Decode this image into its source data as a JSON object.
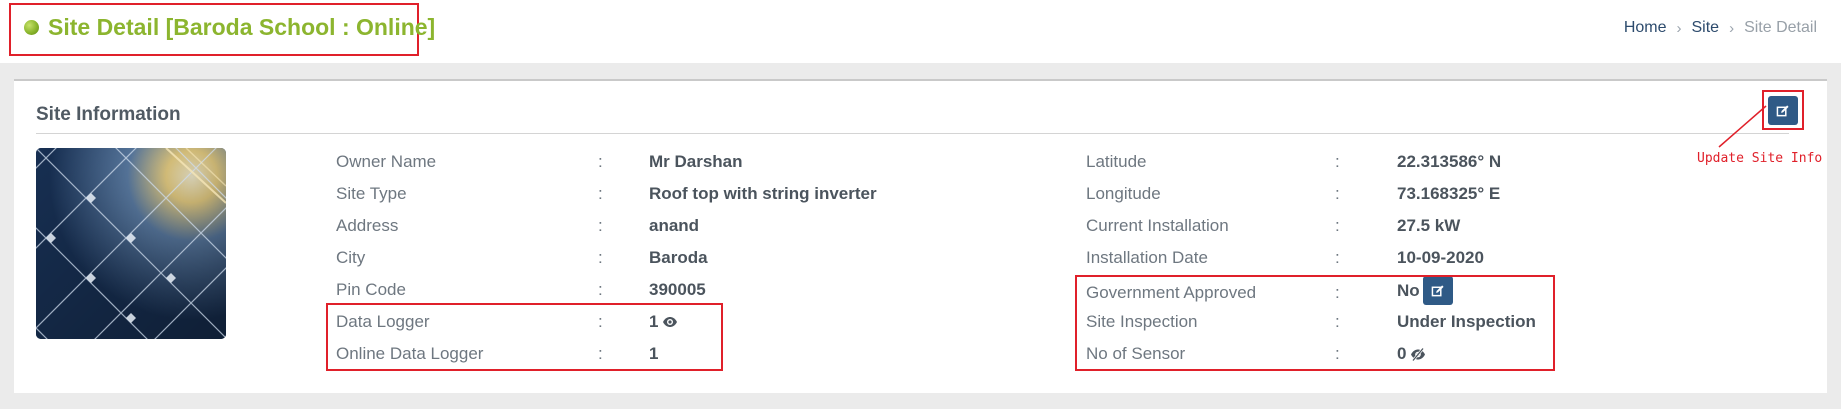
{
  "header": {
    "title": "Site Detail [Baroda School : Online]",
    "status_color": "#8cb52f",
    "breadcrumb": [
      {
        "label": "Home"
      },
      {
        "label": "Site"
      },
      {
        "label": "Site Detail"
      }
    ]
  },
  "card": {
    "title": "Site Information",
    "edit_icon": "edit-icon",
    "annotation_label": "Update Site Info"
  },
  "left_details": [
    {
      "label": "Owner Name",
      "value": "Mr Darshan"
    },
    {
      "label": "Site Type",
      "value": "Roof top with string inverter"
    },
    {
      "label": "Address",
      "value": "anand"
    },
    {
      "label": "City",
      "value": "Baroda"
    },
    {
      "label": "Pin Code",
      "value": "390005"
    },
    {
      "label": "Data Logger",
      "value": "1",
      "icon": "eye-icon"
    },
    {
      "label": "Online Data Logger",
      "value": "1"
    }
  ],
  "right_details": [
    {
      "label": "Latitude",
      "value": "22.313586° N"
    },
    {
      "label": "Longitude",
      "value": "73.168325° E"
    },
    {
      "label": "Current Installation",
      "value": "27.5 kW"
    },
    {
      "label": "Installation Date",
      "value": "10-09-2020"
    },
    {
      "label": "Government Approved",
      "value": "No",
      "icon": "edit-icon"
    },
    {
      "label": "Site Inspection",
      "value": "Under Inspection"
    },
    {
      "label": "No of Sensor",
      "value": "0",
      "icon": "eye-off-icon"
    }
  ],
  "colon": ":",
  "colors": {
    "accent": "#8cb52f",
    "button": "#2f5a86",
    "highlight": "#e0202a"
  }
}
